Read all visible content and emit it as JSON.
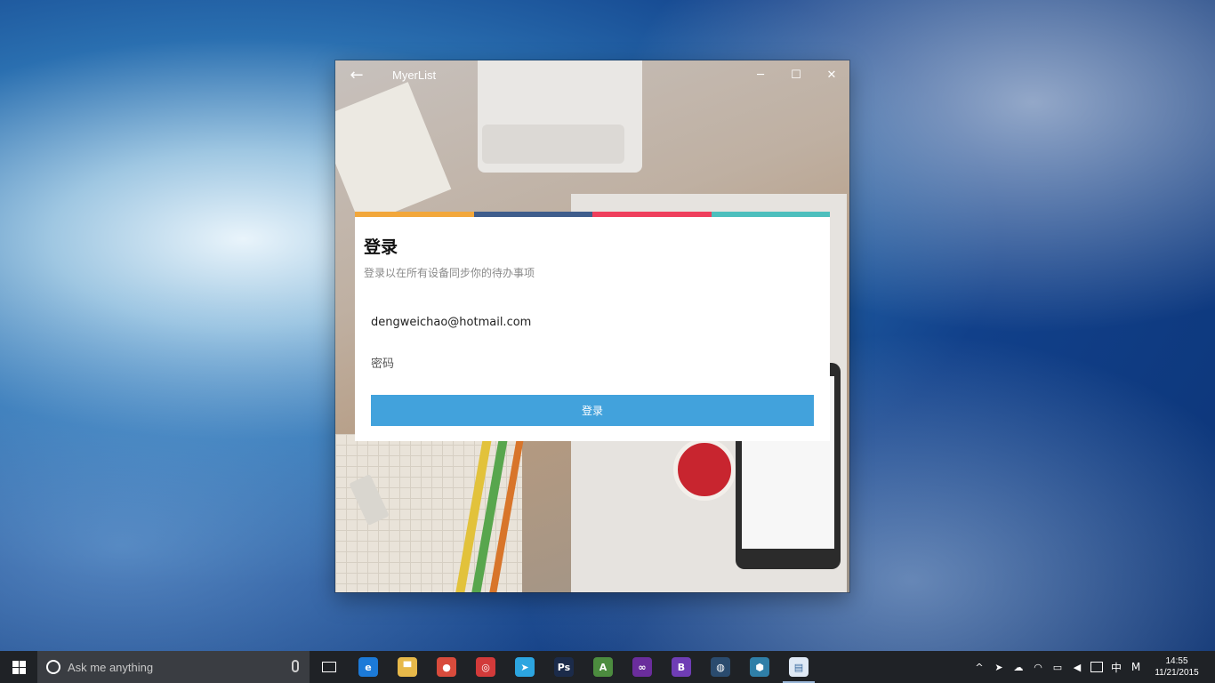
{
  "window": {
    "title": "MyerList",
    "back_glyph": "←",
    "minimize_glyph": "─",
    "maximize_glyph": "☐",
    "close_glyph": "✕"
  },
  "login": {
    "heading": "登录",
    "subtitle": "登录以在所有设备同步你的待办事项",
    "email_value": "dengweichao@hotmail.com",
    "password_placeholder": "密码",
    "submit_label": "登录",
    "accent_colors": [
      "#f2a73b",
      "#3f5d8c",
      "#ef3f5c",
      "#4dbfbd"
    ],
    "button_color": "#42a2dc"
  },
  "taskbar": {
    "search_placeholder": "Ask me anything",
    "apps": [
      {
        "name": "edge-icon",
        "glyph": "e",
        "color": "#1c7ad8",
        "running": false
      },
      {
        "name": "file-explorer-icon",
        "glyph": "▀",
        "color": "#e7b94a",
        "running": false
      },
      {
        "name": "chrome-icon",
        "glyph": "●",
        "color": "#d84b3c",
        "running": false
      },
      {
        "name": "netease-music-icon",
        "glyph": "◎",
        "color": "#d23a3a",
        "running": false
      },
      {
        "name": "telegram-icon",
        "glyph": "➤",
        "color": "#2ca5e0",
        "running": false
      },
      {
        "name": "photoshop-icon",
        "glyph": "Ps",
        "color": "#1b2b4a",
        "running": false
      },
      {
        "name": "android-studio-icon",
        "glyph": "A",
        "color": "#4c8c3f",
        "running": false
      },
      {
        "name": "visual-studio-icon",
        "glyph": "∞",
        "color": "#6a2d9c",
        "running": false
      },
      {
        "name": "blend-icon",
        "glyph": "B",
        "color": "#6f3db5",
        "running": false
      },
      {
        "name": "steam-icon",
        "glyph": "◍",
        "color": "#2a4b6e",
        "running": false
      },
      {
        "name": "network-app-icon",
        "glyph": "⬢",
        "color": "#2f7fa8",
        "running": false
      },
      {
        "name": "myerlist-icon",
        "glyph": "▤",
        "color": "#dfe9f5",
        "running": true
      }
    ],
    "tray": {
      "chevron": "^",
      "send": "➤",
      "cloud": "☁",
      "wifi": "◠",
      "battery": "▭",
      "volume": "◀",
      "ime": "中",
      "ime_mode": "M",
      "time": "14:55",
      "date": "11/21/2015"
    }
  }
}
